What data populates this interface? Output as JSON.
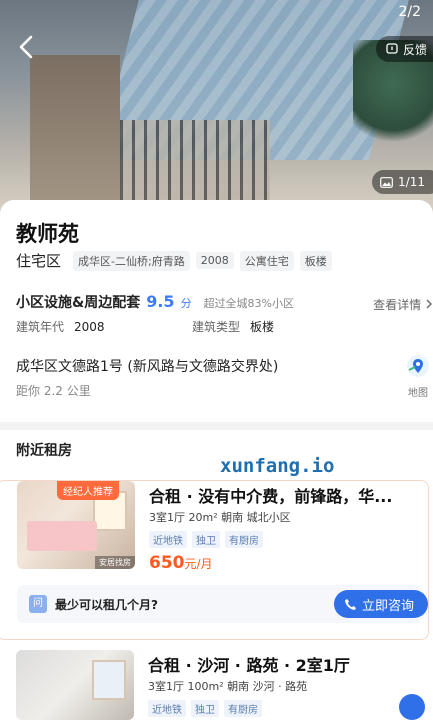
{
  "header": {
    "page_indicator": "2/2",
    "feedback_label": "反馈",
    "photo_count": "1/11"
  },
  "community": {
    "name": "教师苑",
    "type": "住宅区",
    "tags": [
      "成华区-二仙桥;府青路",
      "2008",
      "公寓住宅",
      "板楼"
    ],
    "facility_label": "小区设施&周边配套",
    "facility_score": "9.5",
    "facility_unit": "分",
    "facility_note": "超过全城83%小区",
    "details_link": "查看详情",
    "build_year_label": "建筑年代",
    "build_year": "2008",
    "build_type_label": "建筑类型",
    "build_type": "板楼",
    "address": "成华区文德路1号 (新风路与文德路交界处)",
    "distance": "距你 2.2 公里",
    "map_label": "地图"
  },
  "nearby": {
    "section_title": "附近租房",
    "watermark": "xunfang.io",
    "listings": [
      {
        "badge": "经纪人推荐",
        "photo_tag": "安居找房",
        "title": "合租 · 没有中介费，前锋路，华...",
        "sub": "3室1厅  20m²  朝南  城北小区",
        "tags": [
          "近地铁",
          "独卫",
          "有厨房"
        ],
        "price": "650",
        "price_unit": "元/月",
        "question": "最少可以租几个月?",
        "question_icon": "问",
        "consult_label": "立即咨询"
      },
      {
        "title": "合租 · 沙河 · 路苑 · 2室1厅",
        "sub": "3室1厅  100m²  朝南  沙河 · 路苑",
        "tags": [
          "近地铁",
          "独卫",
          "有厨房"
        ]
      }
    ]
  },
  "colors": {
    "accent": "#2f6fe8",
    "price": "#ff5a1f",
    "score": "#3e7bfa"
  }
}
